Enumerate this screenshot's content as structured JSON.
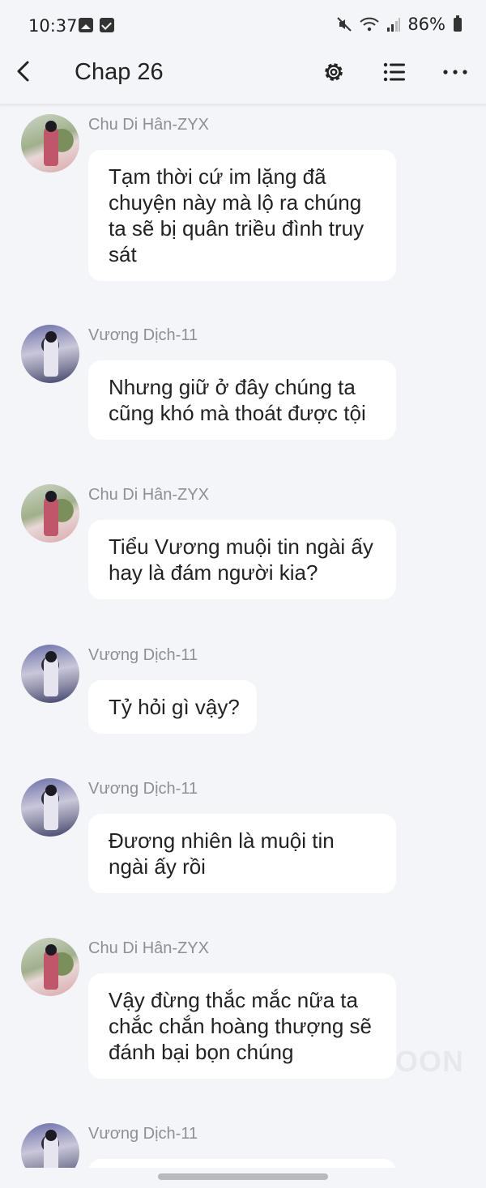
{
  "status_bar": {
    "time": "10:37",
    "battery": "86%",
    "left_icons": [
      "gallery-icon",
      "checkbox-icon"
    ],
    "right_icons": [
      "mute-icon",
      "wifi-icon",
      "signal-icon",
      "battery-icon"
    ]
  },
  "app_bar": {
    "title": "Chap 26",
    "icons": [
      "back-icon",
      "gear-icon",
      "list-icon",
      "more-icon"
    ]
  },
  "messages": [
    {
      "sender": "Chu Di Hân-ZYX",
      "avatar": "chu",
      "lines": [
        "Tạm thời cứ im lặng đã",
        "chuyện này mà lộ ra chúng",
        "ta sẽ bị quân triều đình truy",
        "sát"
      ]
    },
    {
      "sender": "Vương Dịch-11",
      "avatar": "vuong",
      "lines": [
        "Nhưng giữ ở đây chúng ta",
        "cũng khó mà thoát được tội"
      ]
    },
    {
      "sender": "Chu Di Hân-ZYX",
      "avatar": "chu",
      "lines": [
        "Tiểu Vương muội tin ngài ấy",
        "hay là đám người kia?"
      ]
    },
    {
      "sender": "Vương Dịch-11",
      "avatar": "vuong",
      "lines": [
        "Tỷ hỏi gì vậy?"
      ]
    },
    {
      "sender": "Vương Dịch-11",
      "avatar": "vuong",
      "lines": [
        "Đương nhiên là muội tin",
        "ngài ấy rồi"
      ]
    },
    {
      "sender": "Chu Di Hân-ZYX",
      "avatar": "chu",
      "lines": [
        "Vậy đừng thắc mắc nữa ta",
        "chắc chắn hoàng thượng sẽ",
        "đánh bại bọn chúng"
      ]
    },
    {
      "sender": "Vương Dịch-11",
      "avatar": "vuong",
      "lines": [
        ""
      ]
    }
  ],
  "watermark": "OON",
  "colors": {
    "background": "#f4f5f8",
    "bubble": "#ffffff",
    "sender_name": "#8d8f96",
    "text": "#222222"
  }
}
